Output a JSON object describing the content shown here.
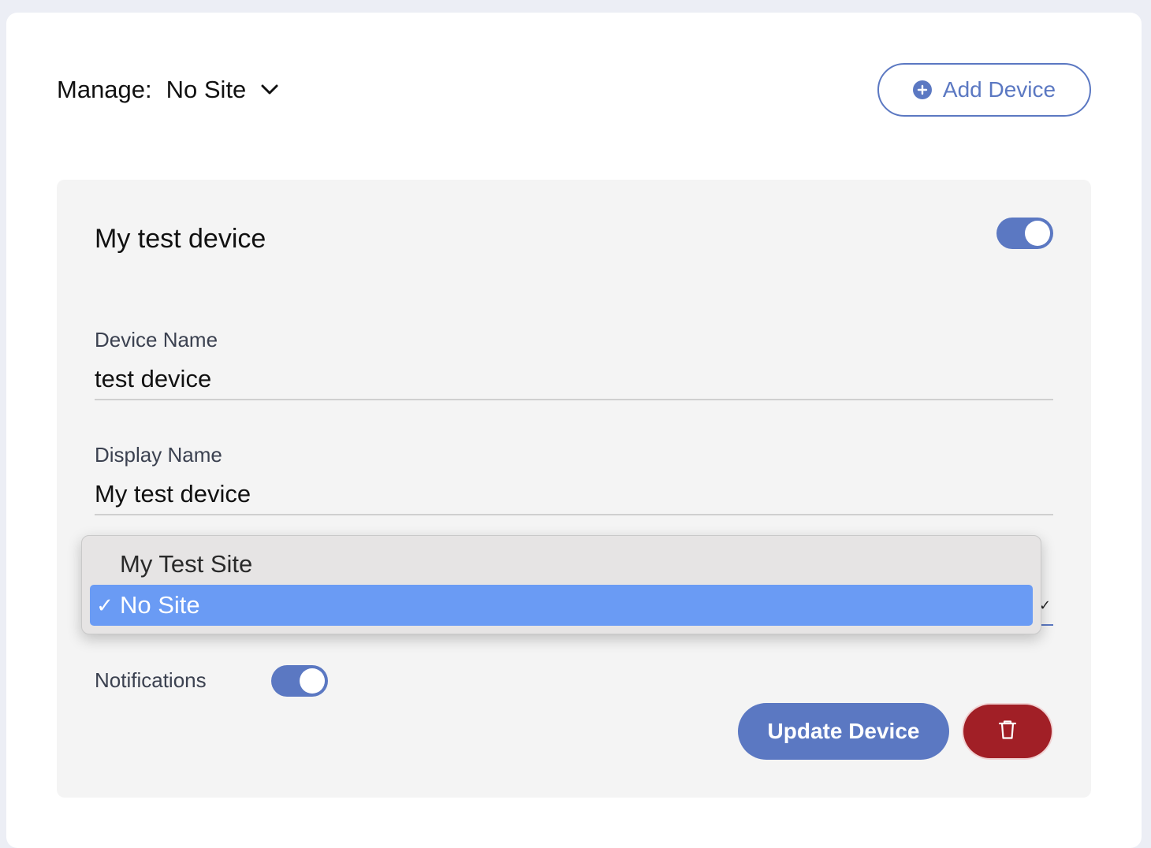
{
  "header": {
    "manage_label": "Manage:",
    "manage_value": "No Site",
    "add_device_label": "Add Device"
  },
  "device": {
    "title": "My test device",
    "enabled": true,
    "fields": {
      "device_name_label": "Device Name",
      "device_name_value": "test device",
      "display_name_label": "Display Name",
      "display_name_value": "My test device"
    },
    "site_dropdown": {
      "options": [
        "My Test Site",
        "No Site"
      ],
      "selected": "No Site",
      "check_mark": "✓"
    },
    "notifications_label": "Notifications",
    "notifications_enabled": true,
    "update_label": "Update Device"
  },
  "colors": {
    "accent": "#5b78c2",
    "danger": "#a11f26",
    "selection": "#6a9bf4"
  },
  "icons": [
    "chevron-down-icon",
    "plus-circle-icon",
    "trash-icon"
  ]
}
